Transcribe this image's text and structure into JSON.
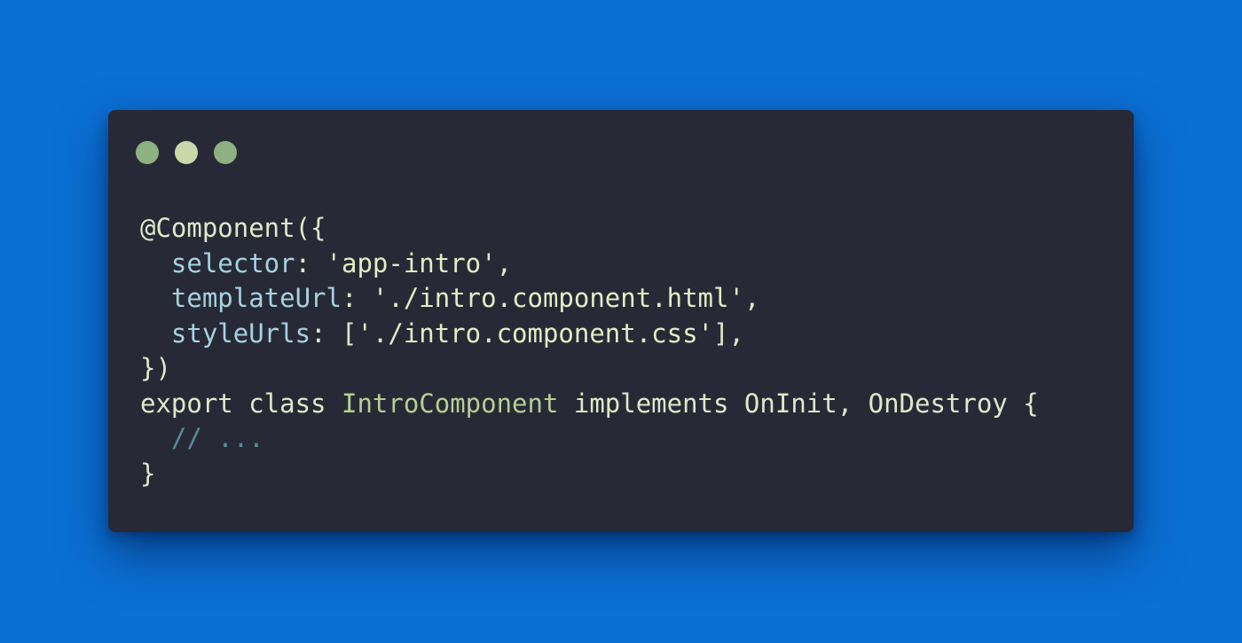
{
  "window": {
    "controls": [
      {
        "name": "close",
        "color": "#8fb080"
      },
      {
        "name": "minimize",
        "color": "#c9d8a8"
      },
      {
        "name": "maximize",
        "color": "#8fb080"
      }
    ]
  },
  "code": {
    "lines": [
      {
        "indent": "",
        "tokens": [
          {
            "text": "@Component({",
            "color": "#dfe8c8"
          }
        ]
      },
      {
        "indent": "  ",
        "tokens": [
          {
            "text": "selector",
            "color": "#a6d2e0"
          },
          {
            "text": ": ",
            "color": "#dfe8c8"
          },
          {
            "text": "'app-intro'",
            "color": "#e4ecc4"
          },
          {
            "text": ",",
            "color": "#dfe8c8"
          }
        ]
      },
      {
        "indent": "  ",
        "tokens": [
          {
            "text": "templateUrl",
            "color": "#a6d2e0"
          },
          {
            "text": ": ",
            "color": "#dfe8c8"
          },
          {
            "text": "'./intro.component.html'",
            "color": "#e4ecc4"
          },
          {
            "text": ",",
            "color": "#dfe8c8"
          }
        ]
      },
      {
        "indent": "  ",
        "tokens": [
          {
            "text": "styleUrls",
            "color": "#a6d2e0"
          },
          {
            "text": ": [",
            "color": "#dfe8c8"
          },
          {
            "text": "'./intro.component.css'",
            "color": "#e4ecc4"
          },
          {
            "text": "],",
            "color": "#dfe8c8"
          }
        ]
      },
      {
        "indent": "",
        "tokens": [
          {
            "text": "})",
            "color": "#dfe8c8"
          }
        ]
      },
      {
        "indent": "",
        "tokens": [
          {
            "text": "export class ",
            "color": "#dfe8c8"
          },
          {
            "text": "IntroComponent",
            "color": "#b5cf93"
          },
          {
            "text": " implements OnInit, OnDestroy {",
            "color": "#dfe8c8"
          }
        ]
      },
      {
        "indent": "  ",
        "tokens": [
          {
            "text": "// ...",
            "color": "#5b8a9c"
          }
        ]
      },
      {
        "indent": "",
        "tokens": [
          {
            "text": "}",
            "color": "#dfe8c8"
          }
        ]
      }
    ]
  }
}
